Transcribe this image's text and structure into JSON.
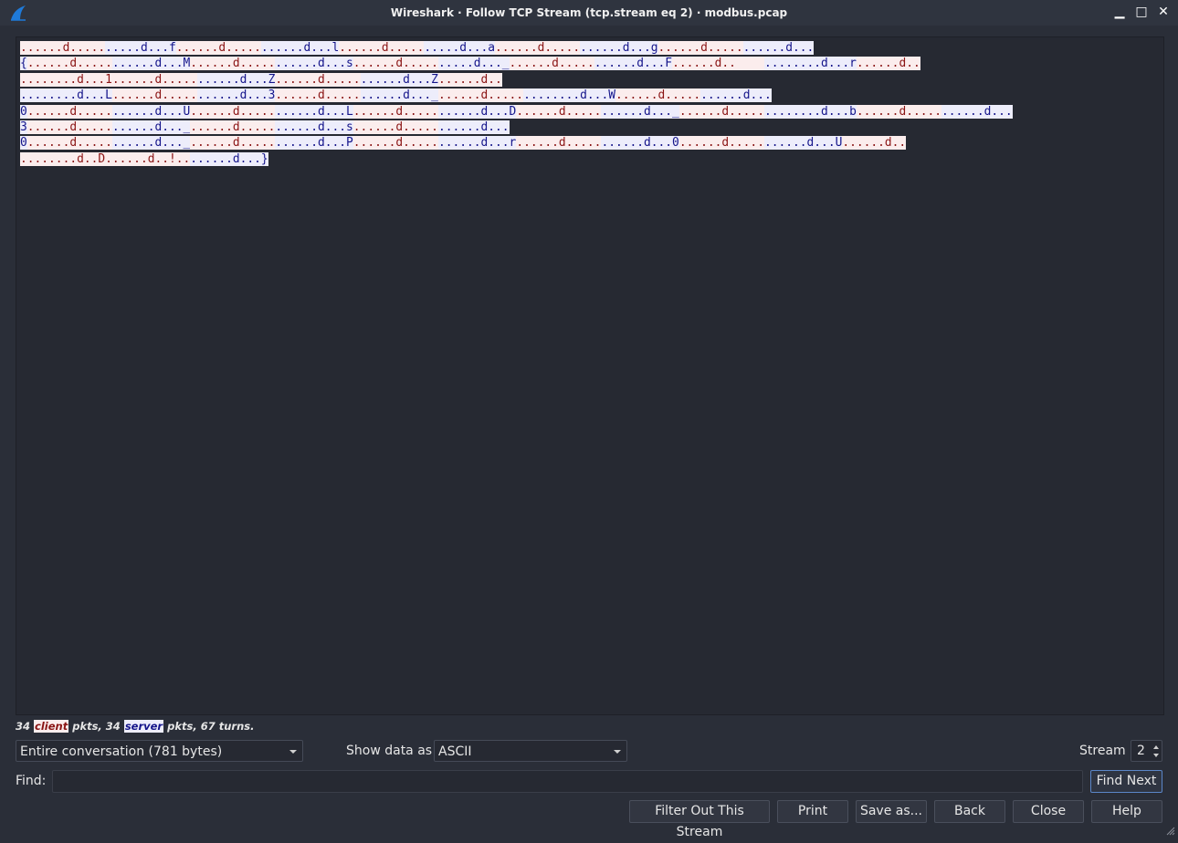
{
  "window": {
    "title": "Wireshark · Follow TCP Stream (tcp.stream eq 2) · modbus.pcap",
    "controls": {
      "minimize": "▁",
      "maximize": "□",
      "close": "✕"
    }
  },
  "stream": {
    "lines": [
      [
        [
          "c",
          "......d....."
        ],
        [
          "s",
          ".....d...f"
        ],
        [
          "c",
          "......d....."
        ],
        [
          "s",
          "......d...l"
        ],
        [
          "c",
          "......d....."
        ],
        [
          "s",
          ".....d...a"
        ],
        [
          "c",
          "......d....."
        ],
        [
          "s",
          "......d...g"
        ],
        [
          "c",
          "......d....."
        ],
        [
          "s",
          "......d..."
        ]
      ],
      [
        [
          "s",
          "{"
        ],
        [
          "c",
          "......d....."
        ],
        [
          "s",
          "......d...M"
        ],
        [
          "c",
          "......d....."
        ],
        [
          "s",
          "......d...s"
        ],
        [
          "c",
          "......d....."
        ],
        [
          "s",
          ".....d..._"
        ],
        [
          "c",
          "......d....."
        ],
        [
          "s",
          "......d...F"
        ],
        [
          "c",
          "......d..    "
        ],
        [
          "s",
          "........d...r"
        ],
        [
          "c",
          "......d.."
        ]
      ],
      [
        [
          "c",
          "........d...1"
        ],
        [
          "c",
          "......d....."
        ],
        [
          "s",
          "......d...Z"
        ],
        [
          "c",
          "......d....."
        ],
        [
          "s",
          "......d...Z"
        ],
        [
          "c",
          "......d.."
        ]
      ],
      [
        [
          "s",
          "........d...L"
        ],
        [
          "c",
          "......d....."
        ],
        [
          "s",
          "......d...3"
        ],
        [
          "c",
          "......d....."
        ],
        [
          "s",
          "......d..._"
        ],
        [
          "c",
          "......d....."
        ],
        [
          "s",
          "........d...W"
        ],
        [
          "c",
          "......d....."
        ],
        [
          "s",
          "......d..."
        ]
      ],
      [
        [
          "s",
          "0"
        ],
        [
          "c",
          "......d....."
        ],
        [
          "s",
          "......d...U"
        ],
        [
          "c",
          "......d....."
        ],
        [
          "s",
          "......d...L"
        ],
        [
          "c",
          "......d....."
        ],
        [
          "s",
          "......d...D"
        ],
        [
          "c",
          "......d....."
        ],
        [
          "s",
          "......d..._"
        ],
        [
          "c",
          "......d....."
        ],
        [
          "s",
          "........d...b"
        ],
        [
          "c",
          "......d....."
        ],
        [
          "s",
          "......d..."
        ]
      ],
      [
        [
          "s",
          "3"
        ],
        [
          "c",
          "......d....."
        ],
        [
          "s",
          "......d..._"
        ],
        [
          "c",
          "......d....."
        ],
        [
          "s",
          "......d...s"
        ],
        [
          "c",
          "......d....."
        ],
        [
          "s",
          "......d..."
        ]
      ],
      [
        [
          "s",
          "0"
        ],
        [
          "c",
          "......d....."
        ],
        [
          "s",
          "......d..._"
        ],
        [
          "c",
          "......d....."
        ],
        [
          "s",
          "......d...P"
        ],
        [
          "c",
          "......d....."
        ],
        [
          "s",
          "......d...r"
        ],
        [
          "c",
          "......d....."
        ],
        [
          "s",
          "......d...0"
        ],
        [
          "c",
          "......d....."
        ],
        [
          "s",
          "......d...U"
        ],
        [
          "c",
          "......d.."
        ]
      ],
      [
        [
          "c",
          "........d..D"
        ],
        [
          "c",
          "......d..!.."
        ],
        [
          "s",
          "......d...}"
        ]
      ]
    ]
  },
  "stats": {
    "client_count": "34 ",
    "client_label": "client",
    "middle": " pkts, 34 ",
    "server_label": "server",
    "suffix": " pkts, 67 turns."
  },
  "conversation_select": {
    "value": "Entire conversation (781 bytes)"
  },
  "show_data": {
    "label": "Show data as",
    "value": "ASCII"
  },
  "stream_spin": {
    "label": "Stream",
    "value": "2"
  },
  "find": {
    "label": "Find:",
    "value": "",
    "button": "Find Next"
  },
  "buttons": {
    "filter_out": "Filter Out This Stream",
    "print": "Print",
    "save_as": "Save as...",
    "back": "Back",
    "close": "Close",
    "help": "Help"
  },
  "colors": {
    "client_bg": "#fbeded",
    "client_fg": "#8a1414",
    "server_bg": "#ededfb",
    "server_fg": "#14148a",
    "window_bg": "#2a2e38"
  }
}
